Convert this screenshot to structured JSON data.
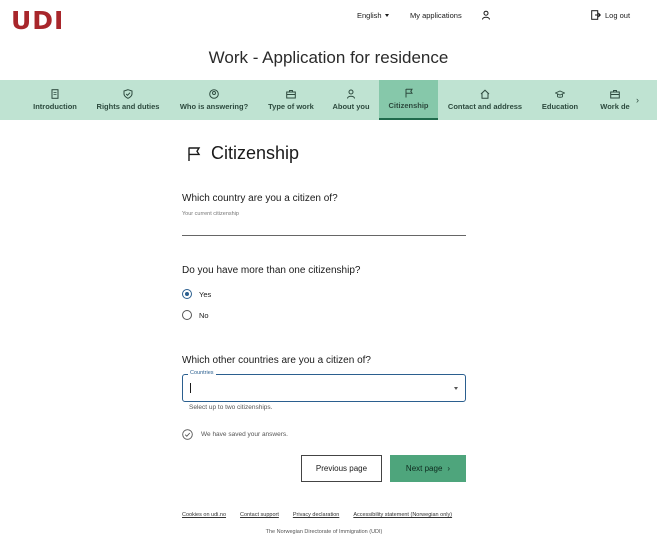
{
  "header": {
    "logo": "UDI",
    "language": "English",
    "my_applications": "My applications",
    "logout": "Log out"
  },
  "page_title": "Work - Application for residence",
  "tabs": [
    {
      "label": "Introduction",
      "icon": "document-icon"
    },
    {
      "label": "Rights and duties",
      "icon": "shield-check-icon"
    },
    {
      "label": "Who is answering?",
      "icon": "person-circle-icon"
    },
    {
      "label": "Type of work",
      "icon": "briefcase-icon"
    },
    {
      "label": "About you",
      "icon": "person-icon"
    },
    {
      "label": "Citizenship",
      "icon": "flag-icon",
      "active": true
    },
    {
      "label": "Contact and address",
      "icon": "house-icon"
    },
    {
      "label": "Education",
      "icon": "graduation-cap-icon"
    },
    {
      "label": "Work de",
      "icon": "briefcase-icon"
    }
  ],
  "section": {
    "title": "Citizenship"
  },
  "questions": {
    "country": {
      "label": "Which country are you a citizen of?",
      "hint": "Your current citizenship",
      "value": ""
    },
    "multiple": {
      "label": "Do you have more than one citizenship?",
      "options": [
        "Yes",
        "No"
      ],
      "selected": "Yes"
    },
    "other_countries": {
      "label": "Which other countries are you a citizen of?",
      "field_label": "Countries",
      "value": "",
      "help": "Select up to two citizenships."
    }
  },
  "status": {
    "saved": "We have saved your answers."
  },
  "buttons": {
    "previous": "Previous page",
    "next": "Next page"
  },
  "footer": {
    "links": [
      "Cookies on udi.no",
      "Contact support",
      "Privacy declaration",
      "Accessibility statement (Norwegian only)"
    ],
    "org": "The Norwegian Directorate of Immigration (UDI)"
  },
  "colors": {
    "brand_red": "#a8262b",
    "tab_bar": "#bfe3d2",
    "tab_active": "#86c8aa",
    "primary_button": "#4ea57c",
    "focus_blue": "#2b5f8f"
  }
}
